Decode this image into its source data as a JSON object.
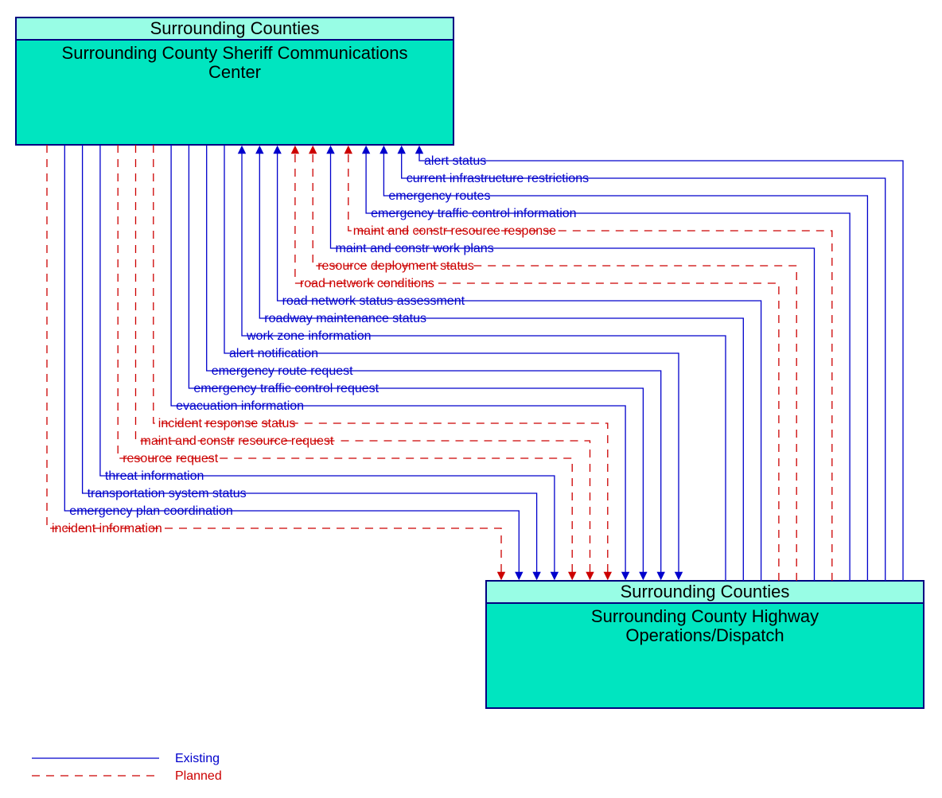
{
  "boxes": {
    "source": {
      "header": "Surrounding Counties",
      "title_line1": "Surrounding County Sheriff Communications",
      "title_line2": "Center"
    },
    "target": {
      "header": "Surrounding Counties",
      "title_line1": "Surrounding County Highway",
      "title_line2": "Operations/Dispatch"
    }
  },
  "flows_to_source": [
    {
      "label": "alert status",
      "status": "existing"
    },
    {
      "label": "current infrastructure restrictions",
      "status": "existing"
    },
    {
      "label": "emergency routes",
      "status": "existing"
    },
    {
      "label": "emergency traffic control information",
      "status": "existing"
    },
    {
      "label": "maint and constr resource response",
      "status": "planned"
    },
    {
      "label": "maint and constr work plans",
      "status": "existing"
    },
    {
      "label": "resource deployment status",
      "status": "planned"
    },
    {
      "label": "road network conditions",
      "status": "planned"
    },
    {
      "label": "road network status assessment",
      "status": "existing"
    },
    {
      "label": "roadway maintenance status",
      "status": "existing"
    },
    {
      "label": "work zone information",
      "status": "existing"
    }
  ],
  "flows_to_target": [
    {
      "label": "alert notification",
      "status": "existing"
    },
    {
      "label": "emergency route request",
      "status": "existing"
    },
    {
      "label": "emergency traffic control request",
      "status": "existing"
    },
    {
      "label": "evacuation information",
      "status": "existing"
    },
    {
      "label": "incident response status",
      "status": "planned"
    },
    {
      "label": "maint and constr resource request",
      "status": "planned"
    },
    {
      "label": "resource request",
      "status": "planned"
    },
    {
      "label": "threat information",
      "status": "existing"
    },
    {
      "label": "transportation system status",
      "status": "existing"
    },
    {
      "label": "emergency plan coordination",
      "status": "existing"
    },
    {
      "label": "incident information",
      "status": "planned"
    }
  ],
  "legend": {
    "existing": "Existing",
    "planned": "Planned"
  },
  "colors": {
    "existing": "#0000CC",
    "planned": "#CC0000",
    "box_header": "#98FDE5",
    "box_body": "#00E5C0",
    "box_border": "#000080"
  }
}
